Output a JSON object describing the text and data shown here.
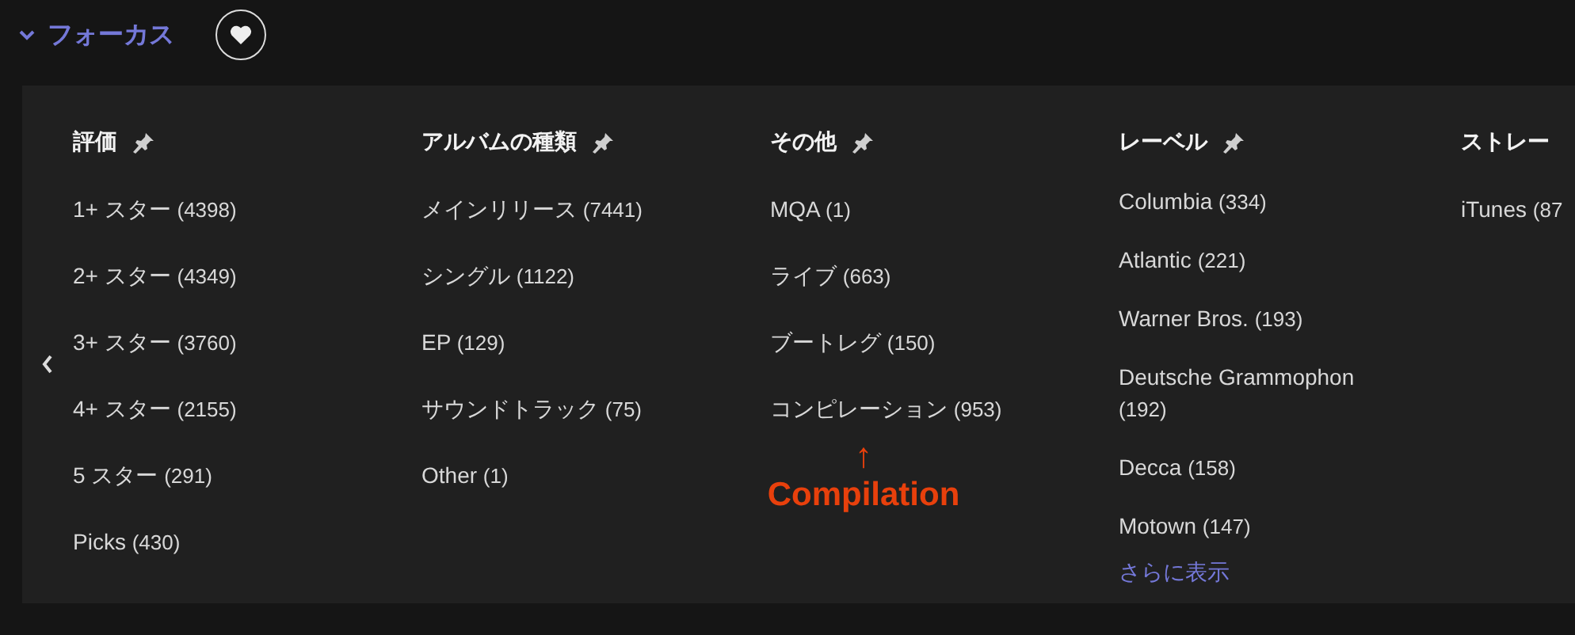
{
  "focus": {
    "title": "フォーカス",
    "expanded": true
  },
  "facets": [
    {
      "title": "評価",
      "pinned": true,
      "items": [
        {
          "label": "1+ スター",
          "count": "(4398)"
        },
        {
          "label": "2+ スター",
          "count": "(4349)"
        },
        {
          "label": "3+ スター",
          "count": "(3760)"
        },
        {
          "label": "4+ スター",
          "count": "(2155)"
        },
        {
          "label": "5 スター",
          "count": "(291)"
        },
        {
          "label": "Picks",
          "count": "(430)"
        }
      ]
    },
    {
      "title": "アルバムの種類",
      "pinned": true,
      "items": [
        {
          "label": "メインリリース",
          "count": "(7441)"
        },
        {
          "label": "シングル",
          "count": "(1122)"
        },
        {
          "label": "EP",
          "count": "(129)"
        },
        {
          "label": "サウンドトラック",
          "count": "(75)"
        },
        {
          "label": "Other",
          "count": "(1)"
        }
      ]
    },
    {
      "title": "その他",
      "pinned": true,
      "items": [
        {
          "label": "MQA",
          "count": "(1)"
        },
        {
          "label": "ライブ",
          "count": "(663)"
        },
        {
          "label": "ブートレグ",
          "count": "(150)"
        },
        {
          "label": "コンピレーション",
          "count": "(953)"
        }
      ],
      "annotation": {
        "arrow": "↑",
        "text": "Compilation"
      }
    },
    {
      "title": "レーベル",
      "pinned": true,
      "items": [
        {
          "label": "Columbia",
          "count": "(334)"
        },
        {
          "label": "Atlantic",
          "count": "(221)"
        },
        {
          "label": "Warner Bros.",
          "count": "(193)"
        },
        {
          "label": "Deutsche Grammophon",
          "count": "(192)"
        },
        {
          "label": "Decca",
          "count": "(158)"
        },
        {
          "label": "Motown",
          "count": "(147)"
        }
      ],
      "more_link": "さらに表示"
    },
    {
      "title": "ストレー",
      "pinned": false,
      "items": [
        {
          "label": "iTunes",
          "count": "(87"
        }
      ]
    }
  ]
}
